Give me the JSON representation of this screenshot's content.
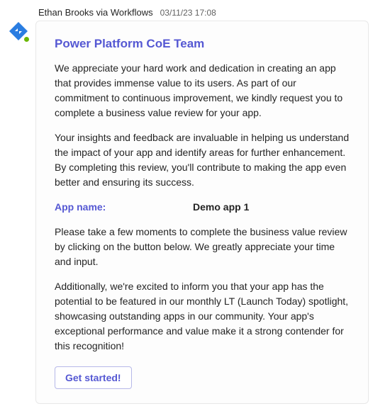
{
  "header": {
    "sender": "Ethan Brooks via Workflows",
    "timestamp": "03/11/23 17:08"
  },
  "card": {
    "title": "Power Platform CoE Team",
    "paragraph1": "We appreciate your hard work and dedication in creating an app that provides immense value to its users. As part of our commitment to continuous improvement, we kindly request you to complete a business value review for your app.",
    "paragraph2": "Your insights and feedback are invaluable in helping us understand the impact of your app and identify areas for further enhancement. By completing this review, you'll contribute to making the app even better and ensuring its success.",
    "app_label": "App name:",
    "app_value": "Demo app 1",
    "paragraph3": "Please take a few moments to complete the business value review by clicking on the button below. We greatly appreciate your time and input.",
    "paragraph4": "Additionally, we're excited to inform you that your app has the potential to be featured in our monthly LT (Launch Today) spotlight, showcasing outstanding apps in our community. Your app's exceptional performance and value make it a strong contender for this recognition!",
    "button_label": "Get started!"
  }
}
